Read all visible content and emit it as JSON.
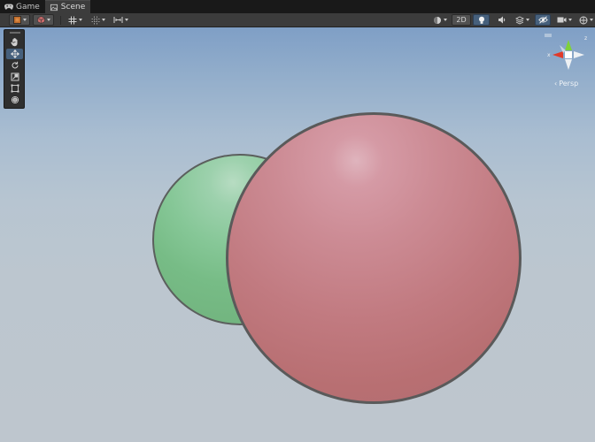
{
  "tabs": [
    {
      "label": "Game",
      "icon": "gamepad-icon",
      "active": false
    },
    {
      "label": "Scene",
      "icon": "scene-icon",
      "active": true
    }
  ],
  "toolbar": {
    "left_buttons": [
      "draw-mode-button",
      "shading-mode-button",
      "grid-button",
      "snap-button",
      "increment-snap-button"
    ],
    "mode_2d_label": "2D",
    "lighting_on": true,
    "gizmos_active": true
  },
  "tools": [
    "hand-tool",
    "move-tool",
    "rotate-tool",
    "scale-tool",
    "rect-tool",
    "transform-tool"
  ],
  "active_tool": "move-tool",
  "scene": {
    "objects": [
      {
        "name": "Green Sphere",
        "color": "#7cc48e"
      },
      {
        "name": "Red Sphere",
        "color": "#c47d83",
        "selected": true
      }
    ],
    "sky_top": "#7f9fc6",
    "sky_bottom": "#bec6ce"
  },
  "gizmo": {
    "projection_label": "Persp",
    "axis_colors": {
      "x": "#e03a2a",
      "y": "#7fd13a",
      "z": "#3a6fe0"
    }
  }
}
